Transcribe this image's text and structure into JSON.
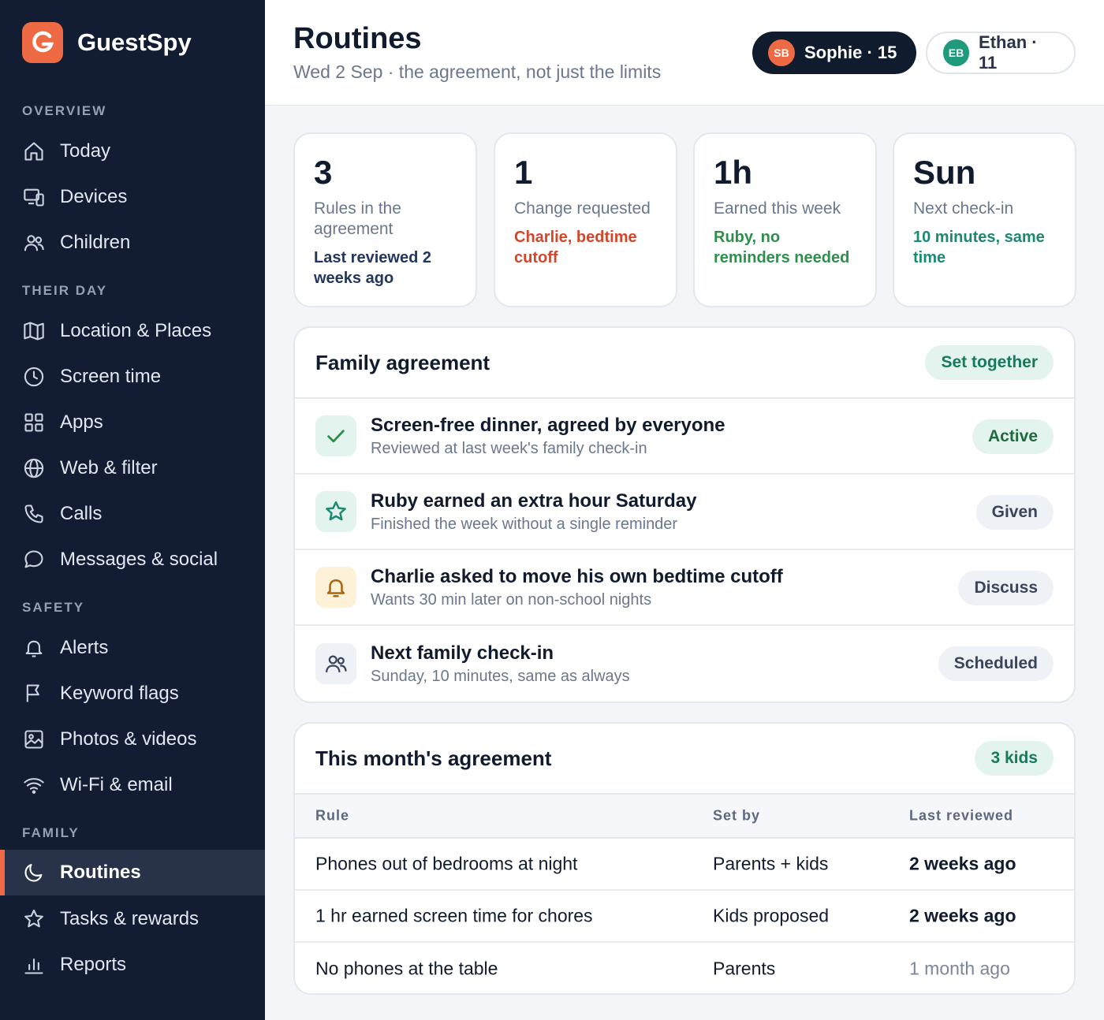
{
  "brand": {
    "logo_letter": "G",
    "name": "GuestSpy"
  },
  "sidebar": {
    "sections": [
      {
        "title": "OVERVIEW",
        "items": [
          {
            "label": "Today",
            "icon": "home-icon"
          },
          {
            "label": "Devices",
            "icon": "devices-icon"
          },
          {
            "label": "Children",
            "icon": "children-icon"
          }
        ]
      },
      {
        "title": "THEIR DAY",
        "items": [
          {
            "label": "Location & Places",
            "icon": "map-icon"
          },
          {
            "label": "Screen time",
            "icon": "clock-icon"
          },
          {
            "label": "Apps",
            "icon": "apps-grid-icon"
          },
          {
            "label": "Web & filter",
            "icon": "globe-icon"
          },
          {
            "label": "Calls",
            "icon": "phone-icon"
          },
          {
            "label": "Messages & social",
            "icon": "chat-bubble-icon"
          }
        ]
      },
      {
        "title": "SAFETY",
        "items": [
          {
            "label": "Alerts",
            "icon": "bell-icon"
          },
          {
            "label": "Keyword flags",
            "icon": "flag-icon"
          },
          {
            "label": "Photos & videos",
            "icon": "image-icon"
          },
          {
            "label": "Wi-Fi & email",
            "icon": "wifi-icon"
          }
        ]
      },
      {
        "title": "FAMILY",
        "items": [
          {
            "label": "Routines",
            "icon": "moon-icon",
            "active": true
          },
          {
            "label": "Tasks & rewards",
            "icon": "star-icon"
          },
          {
            "label": "Reports",
            "icon": "bar-chart-icon"
          }
        ]
      }
    ]
  },
  "header": {
    "title": "Routines",
    "subtitle": "Wed 2 Sep · the agreement, not just the limits",
    "kids": [
      {
        "initials": "SB",
        "label": "Sophie · 15",
        "selected": true,
        "avatar_color": "#ee6a45"
      },
      {
        "initials": "EB",
        "label": "Ethan · 11",
        "selected": false,
        "avatar_color": "#1f9a7a"
      }
    ]
  },
  "stats": [
    {
      "value": "3",
      "label": "Rules in the agreement",
      "note": "Last reviewed 2 weeks ago",
      "note_color": "#23365e"
    },
    {
      "value": "1",
      "label": "Change requested",
      "note": "Charlie, bedtime cutoff",
      "note_color": "#d4462a"
    },
    {
      "value": "1h",
      "label": "Earned this week",
      "note": "Ruby, no reminders needed",
      "note_color": "#2e8f4a"
    },
    {
      "value": "Sun",
      "label": "Next check-in",
      "note": "10 minutes, same time",
      "note_color": "#1a8a72"
    }
  ],
  "agreement": {
    "title": "Family agreement",
    "tag": "Set together",
    "rows": [
      {
        "icon": "check-icon",
        "title": "Screen-free dinner, agreed by everyone",
        "sub": "Reviewed at last week's family check-in",
        "badge": "Active",
        "badge_style": "green"
      },
      {
        "icon": "star-icon",
        "title": "Ruby earned an extra hour Saturday",
        "sub": "Finished the week without a single reminder",
        "badge": "Given",
        "badge_style": "gray"
      },
      {
        "icon": "bell-icon",
        "title": "Charlie asked to move his own bedtime cutoff",
        "sub": "Wants 30 min later on non-school nights",
        "badge": "Discuss",
        "badge_style": "gray"
      },
      {
        "icon": "people-icon",
        "title": "Next family check-in",
        "sub": "Sunday, 10 minutes, same as always",
        "badge": "Scheduled",
        "badge_style": "gray"
      }
    ]
  },
  "monthly": {
    "title": "This month's agreement",
    "tag": "3 kids",
    "columns": [
      "Rule",
      "Set by",
      "Last reviewed"
    ],
    "rows": [
      {
        "rule": "Phones out of bedrooms at night",
        "set_by": "Parents + kids",
        "last_reviewed": "2 weeks ago",
        "bold": true
      },
      {
        "rule": "1 hr earned screen time for chores",
        "set_by": "Kids proposed",
        "last_reviewed": "2 weeks ago",
        "bold": true
      },
      {
        "rule": "No phones at the table",
        "set_by": "Parents",
        "last_reviewed": "1 month ago",
        "bold": false
      }
    ]
  }
}
